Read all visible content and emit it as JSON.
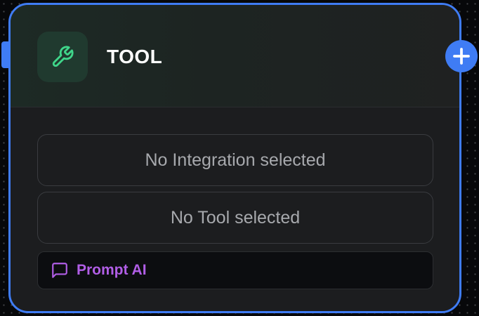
{
  "node": {
    "title": "TOOL",
    "icon": "wrench-icon",
    "integration_placeholder": "No Integration selected",
    "tool_placeholder": "No Tool selected",
    "prompt_label": "Prompt AI",
    "prompt_icon": "message-square-icon"
  },
  "colors": {
    "accent": "#3f7cf4",
    "icon_green": "#3fd68a",
    "prompt_purple": "#b15ee6",
    "node_bg": "#1c1d1f"
  }
}
